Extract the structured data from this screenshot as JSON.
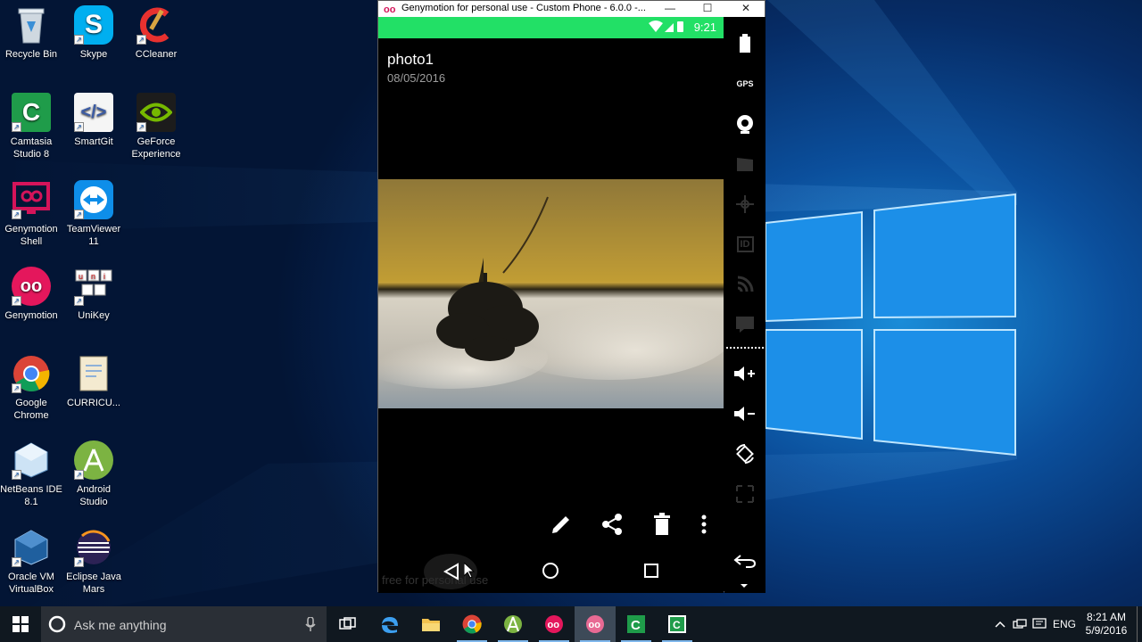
{
  "desktop": {
    "icons": [
      {
        "label": "Recycle Bin",
        "icon": "recycle-bin-icon"
      },
      {
        "label": "Skype",
        "icon": "skype-icon"
      },
      {
        "label": "CCleaner",
        "icon": "ccleaner-icon"
      },
      {
        "label": "Camtasia Studio 8",
        "icon": "camtasia-icon"
      },
      {
        "label": "SmartGit",
        "icon": "smartgit-icon"
      },
      {
        "label": "GeForce Experience",
        "icon": "geforce-icon"
      },
      {
        "label": "Genymotion Shell",
        "icon": "genymotion-shell-icon"
      },
      {
        "label": "TeamViewer 11",
        "icon": "teamviewer-icon"
      },
      {
        "label": "Genymotion",
        "icon": "genymotion-icon"
      },
      {
        "label": "UniKey",
        "icon": "unikey-icon"
      },
      {
        "label": "Google Chrome",
        "icon": "chrome-icon"
      },
      {
        "label": "CURRICU...",
        "icon": "document-icon"
      },
      {
        "label": "NetBeans IDE 8.1",
        "icon": "netbeans-icon"
      },
      {
        "label": "Android Studio",
        "icon": "android-studio-icon"
      },
      {
        "label": "Oracle VM VirtualBox",
        "icon": "virtualbox-icon"
      },
      {
        "label": "Eclipse Java Mars",
        "icon": "eclipse-icon"
      }
    ]
  },
  "emulator": {
    "title": "Genymotion for personal use - Custom Phone - 6.0.0 -...",
    "status": {
      "time": "9:21",
      "icons": "wifi-icon signal-icon battery-icon"
    },
    "photo_title": "photo1",
    "photo_date": "08/05/2016",
    "actions": [
      "edit-icon",
      "share-icon",
      "delete-icon",
      "more-icon"
    ],
    "nav": [
      "back-icon",
      "home-icon",
      "recents-icon"
    ],
    "watermark": "free for personal use",
    "side_panel": [
      {
        "name": "battery-widget",
        "label": ""
      },
      {
        "name": "gps-widget",
        "label": "GPS"
      },
      {
        "name": "camera-widget",
        "label": ""
      },
      {
        "name": "video-capture-widget",
        "label": ""
      },
      {
        "name": "move-widget",
        "label": ""
      },
      {
        "name": "identifiers-widget",
        "label": "ID"
      },
      {
        "name": "cast-widget",
        "label": ""
      },
      {
        "name": "sms-widget",
        "label": ""
      },
      {
        "name": "volume-up-button",
        "label": ""
      },
      {
        "name": "volume-down-button",
        "label": ""
      },
      {
        "name": "rotate-button",
        "label": ""
      },
      {
        "name": "scale-button",
        "label": ""
      },
      {
        "name": "back-button",
        "label": ""
      }
    ]
  },
  "taskbar": {
    "search_placeholder": "Ask me anything",
    "apps": [
      "task-view-icon",
      "edge-icon",
      "file-explorer-icon",
      "chrome-icon",
      "android-studio-icon",
      "genymotion-icon",
      "genymotion-player-icon",
      "camtasia-icon",
      "camtasia-recorder-icon"
    ],
    "language": "ENG",
    "time": "8:21 AM",
    "date": "5/9/2016"
  },
  "colors": {
    "statusbar": "#22e066",
    "taskbar": "#101820",
    "desktop_blue": "#0b4f9c"
  }
}
